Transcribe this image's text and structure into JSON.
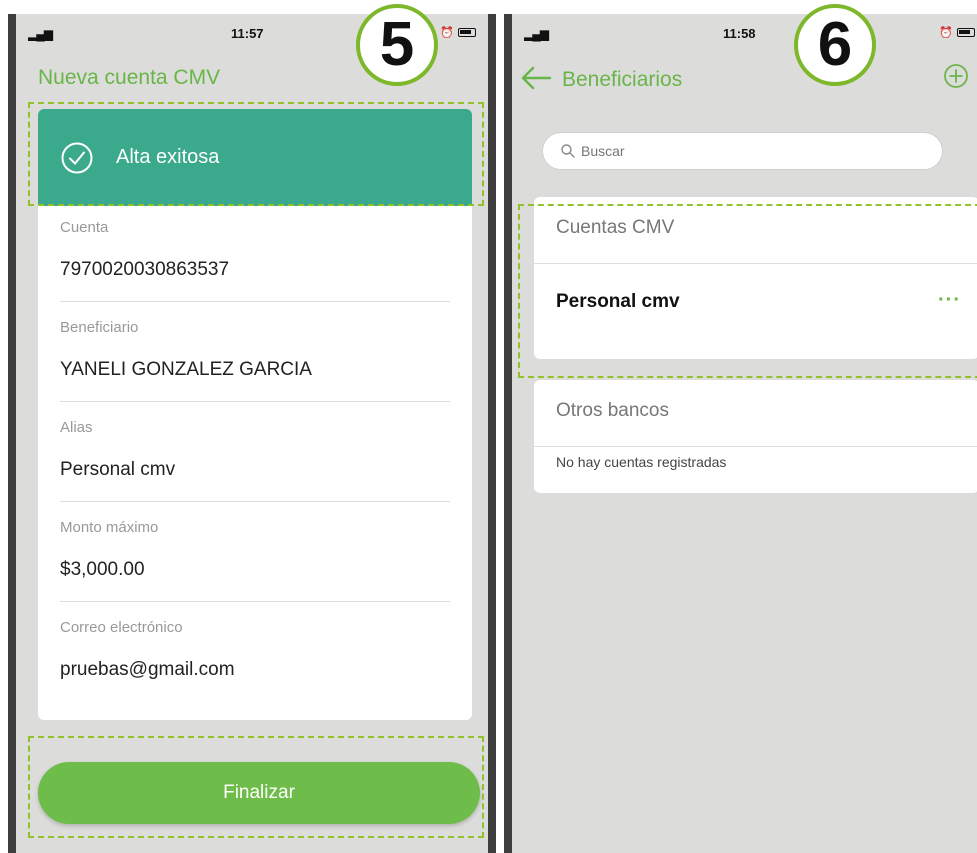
{
  "left_screen": {
    "status": {
      "signal": "▂▄▆",
      "time": "11:57",
      "alarm": "⏰"
    },
    "step_number": "5",
    "title": "Nueva cuenta CMV",
    "success_message": "Alta exitosa",
    "fields": [
      {
        "label": "Cuenta",
        "value": "7970020030863537"
      },
      {
        "label": "Beneficiario",
        "value": "YANELI GONZALEZ GARCIA"
      },
      {
        "label": "Alias",
        "value": "Personal cmv"
      },
      {
        "label": "Monto máximo",
        "value": "$3,000.00"
      },
      {
        "label": "Correo electrónico",
        "value": "pruebas@gmail.com"
      }
    ],
    "finish_label": "Finalizar"
  },
  "right_screen": {
    "status": {
      "signal": "▂▄▆",
      "time": "11:58",
      "alarm": "⏰"
    },
    "step_number": "6",
    "title": "Beneficiarios",
    "search_placeholder": "Buscar",
    "sections": [
      {
        "title": "Cuentas CMV",
        "accounts": [
          "Personal cmv"
        ],
        "more_label": "···"
      },
      {
        "title": "Otros bancos",
        "empty_text": "No hay cuentas registradas"
      }
    ]
  },
  "colors": {
    "brand_green": "#6ab54a",
    "success_teal": "#3ba98b",
    "highlight_dash": "#93c12b",
    "button_green": "#6ebd4a",
    "screen_bg": "#dcdcda"
  },
  "icons": {
    "success": "check-circle-icon",
    "back": "arrow-left-icon",
    "add": "plus-circle-icon",
    "search": "search-icon",
    "more": "more-horizontal-icon"
  }
}
